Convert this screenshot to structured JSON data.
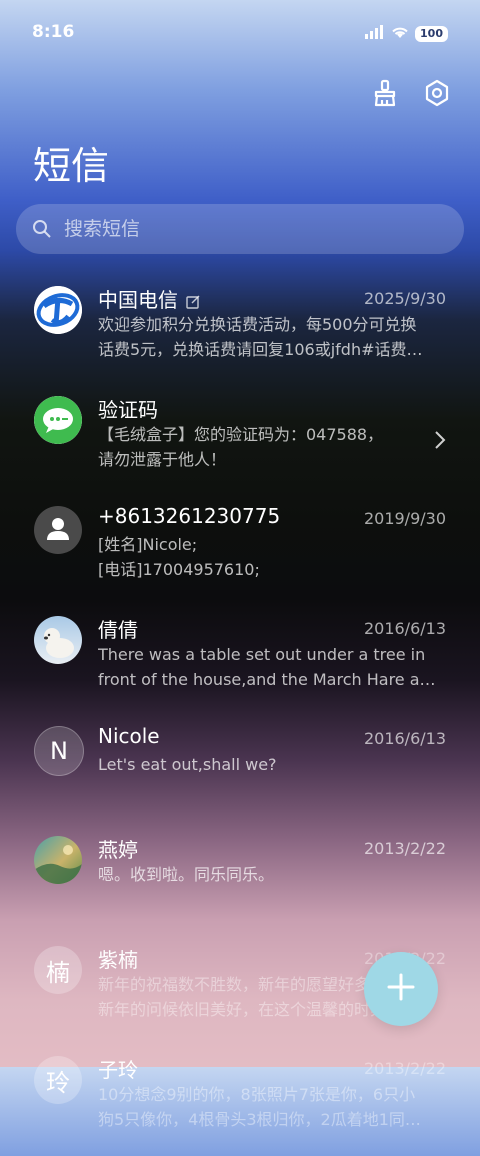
{
  "status_bar": {
    "time": "8:16",
    "battery": "100"
  },
  "header": {
    "title": "短信"
  },
  "search": {
    "placeholder": "搜索短信"
  },
  "conversations": [
    {
      "name": "中国电信",
      "date": "2025/9/30",
      "line1": "欢迎参加积分兑换话费活动，每500分可兑换",
      "line2": "话费5元，兑换话费请回复106或jfdh#话费…",
      "avatar_type": "telecom-logo"
    },
    {
      "name": "验证码",
      "date": "",
      "line1": "【毛绒盒子】您的验证码为：047588，",
      "line2": "请勿泄露于他人！",
      "avatar_type": "message-bubble-icon"
    },
    {
      "name": "+8613261230775",
      "date": "2019/9/30",
      "line1": "[姓名]Nicole;",
      "line2": "[电话]17004957610;",
      "avatar_type": "person-icon"
    },
    {
      "name": "倩倩",
      "date": "2016/6/13",
      "line1": "There was a table set out under a tree in",
      "line2": "front of the house,and the March Hare an…",
      "avatar_type": "photo-polar-bear"
    },
    {
      "name": "Nicole",
      "date": "2016/6/13",
      "line1": "Let's eat out,shall we?",
      "line2": "",
      "avatar_letter": "N"
    },
    {
      "name": "燕婷",
      "date": "2013/2/22",
      "line1": "嗯。收到啦。同乐同乐。",
      "line2": "",
      "avatar_type": "photo-landscape"
    },
    {
      "name": "紫楠",
      "date": "2013/2/22",
      "line1": "新年的祝福数不胜数，新年的愿望好多好多，",
      "line2": "新年的问候依旧美好，在这个温馨的时刻…",
      "avatar_letter": "楠"
    },
    {
      "name": "子玲",
      "date": "2013/2/22",
      "line1": "10分想念9别的你，8张照片7张是你，6只小",
      "line2": "狗5只像你，4根骨头3根归你，2瓜着地1同…",
      "avatar_letter": "玲"
    }
  ],
  "colors": {
    "accent_fab": "#9fd8e6",
    "telecom_blue": "#1e6bd6",
    "bubble_green": "#3fbb4f"
  }
}
